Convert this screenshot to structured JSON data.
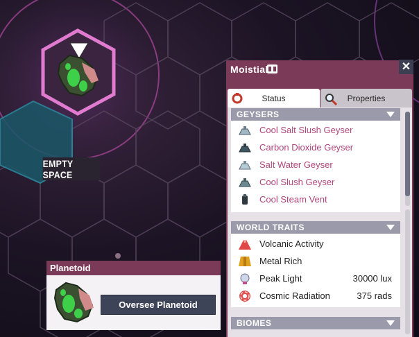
{
  "starmap": {
    "empty_label": "EMPTY SPACE"
  },
  "planetoid_panel": {
    "title": "Planetoid",
    "button_label": "Oversee Planetoid"
  },
  "side_panel": {
    "title": "Moistial",
    "close_label": "✕",
    "tabs": [
      {
        "label": "Status",
        "icon": "status-gear-icon",
        "active": true
      },
      {
        "label": "Properties",
        "icon": "magnifier-icon",
        "active": false
      }
    ],
    "sections": {
      "geysers": {
        "title": "GEYSERS",
        "items": [
          {
            "label": "Cool Salt Slush Geyser",
            "icon": "geyser-icon"
          },
          {
            "label": "Carbon Dioxide Geyser",
            "icon": "geyser-icon"
          },
          {
            "label": "Salt Water Geyser",
            "icon": "geyser-icon"
          },
          {
            "label": "Cool Slush Geyser",
            "icon": "geyser-icon"
          },
          {
            "label": "Cool Steam Vent",
            "icon": "vent-icon"
          }
        ]
      },
      "world_traits": {
        "title": "WORLD TRAITS",
        "items": [
          {
            "label": "Volcanic Activity",
            "value": "",
            "icon": "volcano-icon"
          },
          {
            "label": "Metal Rich",
            "value": "",
            "icon": "metal-icon"
          },
          {
            "label": "Peak Light",
            "value": "30000 lux",
            "icon": "light-icon"
          },
          {
            "label": "Cosmic Radiation",
            "value": "375 rads",
            "icon": "radiation-icon"
          }
        ]
      },
      "biomes": {
        "title": "BIOMES"
      }
    }
  },
  "colors": {
    "panel_header": "#7b3a58",
    "geyser_text": "#b0457c",
    "hex_pink": "#e07bd0",
    "hex_teal": "#1f6d7c"
  }
}
